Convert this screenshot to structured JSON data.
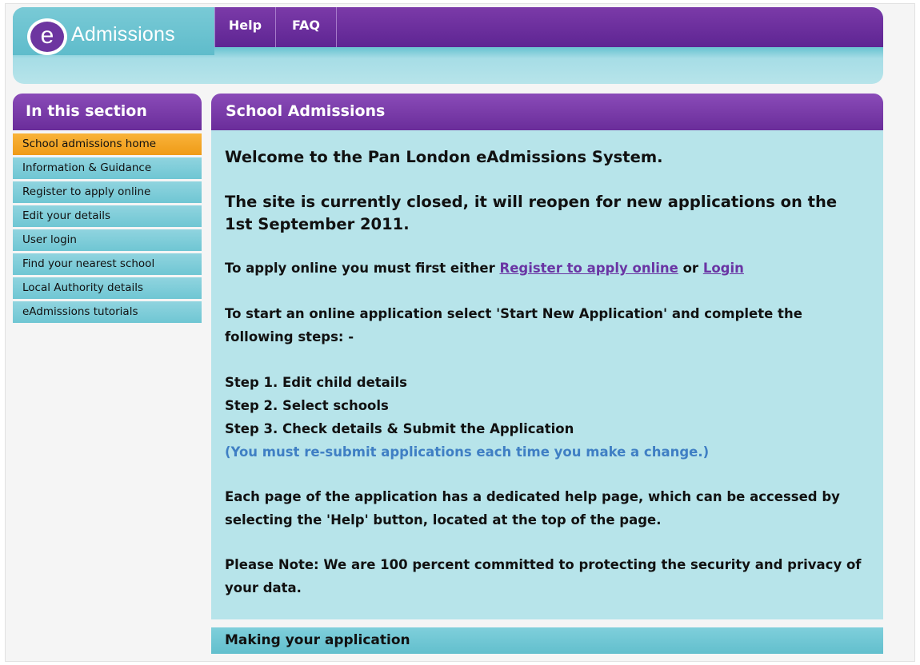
{
  "header": {
    "logo_letter": "e",
    "logo_text": "Admissions",
    "nav": {
      "help": "Help",
      "faq": "FAQ"
    }
  },
  "sidebar": {
    "title": "In this section",
    "items": [
      {
        "label": "School admissions home",
        "active": true
      },
      {
        "label": "Information & Guidance"
      },
      {
        "label": "Register to apply online"
      },
      {
        "label": "Edit your details"
      },
      {
        "label": "User login"
      },
      {
        "label": "Find your nearest school"
      },
      {
        "label": "Local Authority details"
      },
      {
        "label": "eAdmissions tutorials"
      }
    ]
  },
  "main": {
    "title": "School Admissions",
    "welcome": "Welcome to the Pan London eAdmissions System.",
    "closed": "The site is currently closed, it will reopen for new applications on the 1st September 2011.",
    "apply_prefix": "To apply online you must first either",
    "register_link": "Register to apply online",
    "or_text": "or",
    "login_link": "Login",
    "start_text": "To start an online application select 'Start New Application' and complete the following steps: -",
    "steps": [
      "Step 1. Edit child details",
      "Step 2. Select schools",
      "Step 3. Check details & Submit the Application"
    ],
    "resubmit_note": "(You must re-submit applications each time you make a change.)",
    "help_text": "Each page of the application has a dedicated help page, which can be accessed by selecting the 'Help' button, located at the top of the page.",
    "note_text": "Please Note: We are 100 percent committed to protecting the security and privacy of your data.",
    "next_section": "Making your application"
  },
  "colors": {
    "purple": "#6a2d9a",
    "teal": "#6fc6d3",
    "light_teal": "#b7e4ea",
    "orange_active": "#ef9b17",
    "link": "#6a35a4",
    "note_blue": "#3f7fc4"
  }
}
